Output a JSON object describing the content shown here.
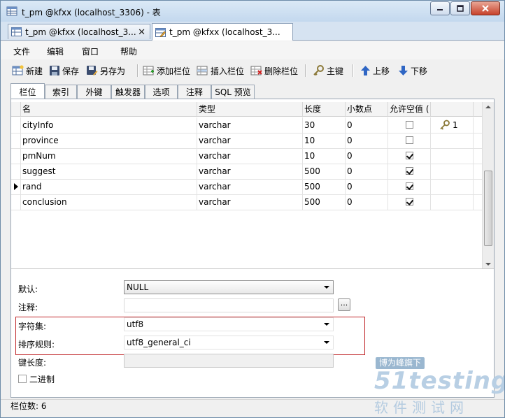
{
  "window": {
    "title": "t_pm @kfxx (localhost_3306) - 表"
  },
  "doc_tabs": [
    {
      "label": "t_pm @kfxx (localhost_3...",
      "active": false
    },
    {
      "label": "t_pm @kfxx (localhost_3...",
      "active": true
    }
  ],
  "menu": {
    "file": "文件",
    "edit": "编辑",
    "window": "窗口",
    "help": "帮助"
  },
  "toolbar": {
    "new": "新建",
    "save": "保存",
    "save_as": "另存为",
    "add_column": "添加栏位",
    "insert_column": "插入栏位",
    "delete_column": "删除栏位",
    "primary_key": "主键",
    "move_up": "上移",
    "move_down": "下移"
  },
  "sub_tabs": [
    {
      "label": "栏位",
      "active": true
    },
    {
      "label": "索引",
      "active": false
    },
    {
      "label": "外键",
      "active": false
    },
    {
      "label": "触发器",
      "active": false
    },
    {
      "label": "选项",
      "active": false
    },
    {
      "label": "注释",
      "active": false
    },
    {
      "label": "SQL 预览",
      "active": false
    }
  ],
  "grid": {
    "headers": [
      "名",
      "类型",
      "长度",
      "小数点",
      "允许空值 ("
    ],
    "rows": [
      {
        "name": "cityInfo",
        "type": "varchar",
        "length": "30",
        "decimals": "0",
        "nullable": false,
        "key": "1",
        "current": false
      },
      {
        "name": "province",
        "type": "varchar",
        "length": "10",
        "decimals": "0",
        "nullable": false,
        "key": "",
        "current": false
      },
      {
        "name": "pmNum",
        "type": "varchar",
        "length": "10",
        "decimals": "0",
        "nullable": true,
        "key": "",
        "current": false
      },
      {
        "name": "suggest",
        "type": "varchar",
        "length": "500",
        "decimals": "0",
        "nullable": true,
        "key": "",
        "current": false
      },
      {
        "name": "rand",
        "type": "varchar",
        "length": "500",
        "decimals": "0",
        "nullable": true,
        "key": "",
        "current": true
      },
      {
        "name": "conclusion",
        "type": "varchar",
        "length": "500",
        "decimals": "0",
        "nullable": true,
        "key": "",
        "current": false
      }
    ]
  },
  "properties": {
    "default_label": "默认:",
    "default_value": "NULL",
    "comment_label": "注释:",
    "comment_value": "",
    "comment_button": "...",
    "charset_label": "字符集:",
    "charset_value": "utf8",
    "collation_label": "排序规则:",
    "collation_value": "utf8_general_ci",
    "key_length_label": "键长度:",
    "key_length_value": "",
    "binary_label": "二进制",
    "binary_checked": false
  },
  "status": {
    "text": "栏位数: 6"
  },
  "watermark": {
    "badge": "博为峰旗下",
    "logo": "51testing",
    "sub": "软件测试网"
  },
  "colors": {
    "highlight_box": "#c0282b",
    "title_bar": "#c3d8ee",
    "watermark": "#b8cfe4"
  }
}
